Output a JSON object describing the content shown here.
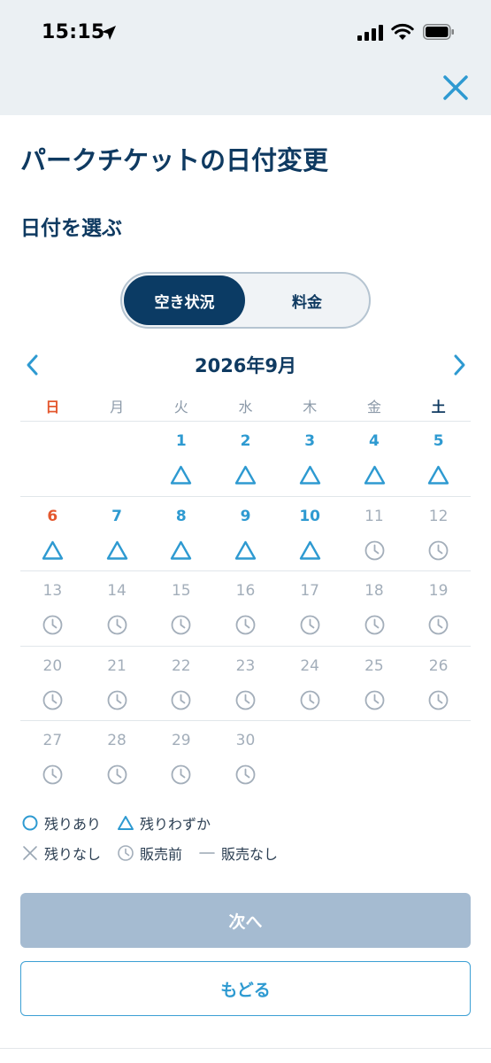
{
  "status_bar": {
    "time": "15:15"
  },
  "header": {
    "title": "パークチケットの日付変更",
    "section": "日付を選ぶ"
  },
  "toggle": {
    "options": [
      "空き状況",
      "料金"
    ],
    "selected": "空き状況"
  },
  "calendar": {
    "month_label": "2026年9月",
    "weekdays": [
      "日",
      "月",
      "火",
      "水",
      "木",
      "金",
      "土"
    ],
    "weeks": [
      [
        null,
        null,
        {
          "day": "1",
          "status": "few"
        },
        {
          "day": "2",
          "status": "few"
        },
        {
          "day": "3",
          "status": "few"
        },
        {
          "day": "4",
          "status": "few"
        },
        {
          "day": "5",
          "status": "few"
        }
      ],
      [
        {
          "day": "6",
          "status": "few"
        },
        {
          "day": "7",
          "status": "few"
        },
        {
          "day": "8",
          "status": "few"
        },
        {
          "day": "9",
          "status": "few"
        },
        {
          "day": "10",
          "status": "few"
        },
        {
          "day": "11",
          "status": "pre"
        },
        {
          "day": "12",
          "status": "pre"
        }
      ],
      [
        {
          "day": "13",
          "status": "pre"
        },
        {
          "day": "14",
          "status": "pre"
        },
        {
          "day": "15",
          "status": "pre"
        },
        {
          "day": "16",
          "status": "pre"
        },
        {
          "day": "17",
          "status": "pre"
        },
        {
          "day": "18",
          "status": "pre"
        },
        {
          "day": "19",
          "status": "pre"
        }
      ],
      [
        {
          "day": "20",
          "status": "pre"
        },
        {
          "day": "21",
          "status": "pre"
        },
        {
          "day": "22",
          "status": "pre"
        },
        {
          "day": "23",
          "status": "pre"
        },
        {
          "day": "24",
          "status": "pre"
        },
        {
          "day": "25",
          "status": "pre"
        },
        {
          "day": "26",
          "status": "pre"
        }
      ],
      [
        {
          "day": "27",
          "status": "pre"
        },
        {
          "day": "28",
          "status": "pre"
        },
        {
          "day": "29",
          "status": "pre"
        },
        {
          "day": "30",
          "status": "pre"
        },
        null,
        null,
        null
      ]
    ]
  },
  "legend": {
    "available": "残りあり",
    "few": "残りわずか",
    "none": "残りなし",
    "pre": "販売前",
    "no_sale": "販売なし"
  },
  "buttons": {
    "next": "次へ",
    "back": "もどる"
  },
  "colors": {
    "navy": "#0b3b64",
    "accent_blue": "#2e9ad1",
    "sunday_red": "#e4582f",
    "disabled_gray": "#a3aeba",
    "next_button_disabled": "#a5bbd1"
  }
}
